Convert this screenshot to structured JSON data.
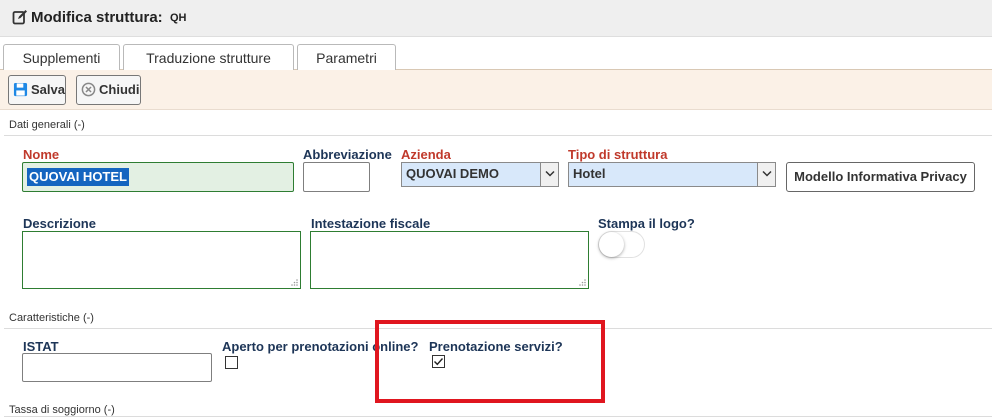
{
  "header": {
    "title": "Modifica struttura:",
    "code": "QH"
  },
  "tabs": [
    {
      "label": "Supplementi"
    },
    {
      "label": "Traduzione strutture"
    },
    {
      "label": "Parametri"
    }
  ],
  "toolbar": {
    "save_label": "Salva",
    "close_label": "Chiudi"
  },
  "sections": {
    "general": "Dati generali (-)",
    "features": "Caratteristiche (-)",
    "tax": "Tassa di soggiorno (-)"
  },
  "general": {
    "name_label": "Nome",
    "name_value": "QUOVAI HOTEL",
    "abbr_label": "Abbreviazione",
    "abbr_value": "",
    "company_label": "Azienda",
    "company_value": "QUOVAI DEMO",
    "type_label": "Tipo di struttura",
    "type_value": "Hotel",
    "privacy_button": "Modello Informativa Privacy",
    "description_label": "Descrizione",
    "fiscal_label": "Intestazione fiscale",
    "print_logo_label": "Stampa il logo?",
    "print_logo_on": false
  },
  "features": {
    "istat_label": "ISTAT",
    "istat_value": "",
    "online_label": "Aperto per prenotazioni online?",
    "online_checked": false,
    "services_label": "Prenotazione servizi?",
    "services_checked": true
  },
  "colors": {
    "required_label": "#c0392b",
    "label": "#1d3557",
    "highlight_box": "#e0161f",
    "selected_text_bg": "#1565c0"
  },
  "icons": [
    "edit-icon",
    "save-icon",
    "close-circle-icon",
    "chevron-down-icon",
    "resize-grip-icon",
    "checkmark-icon"
  ]
}
